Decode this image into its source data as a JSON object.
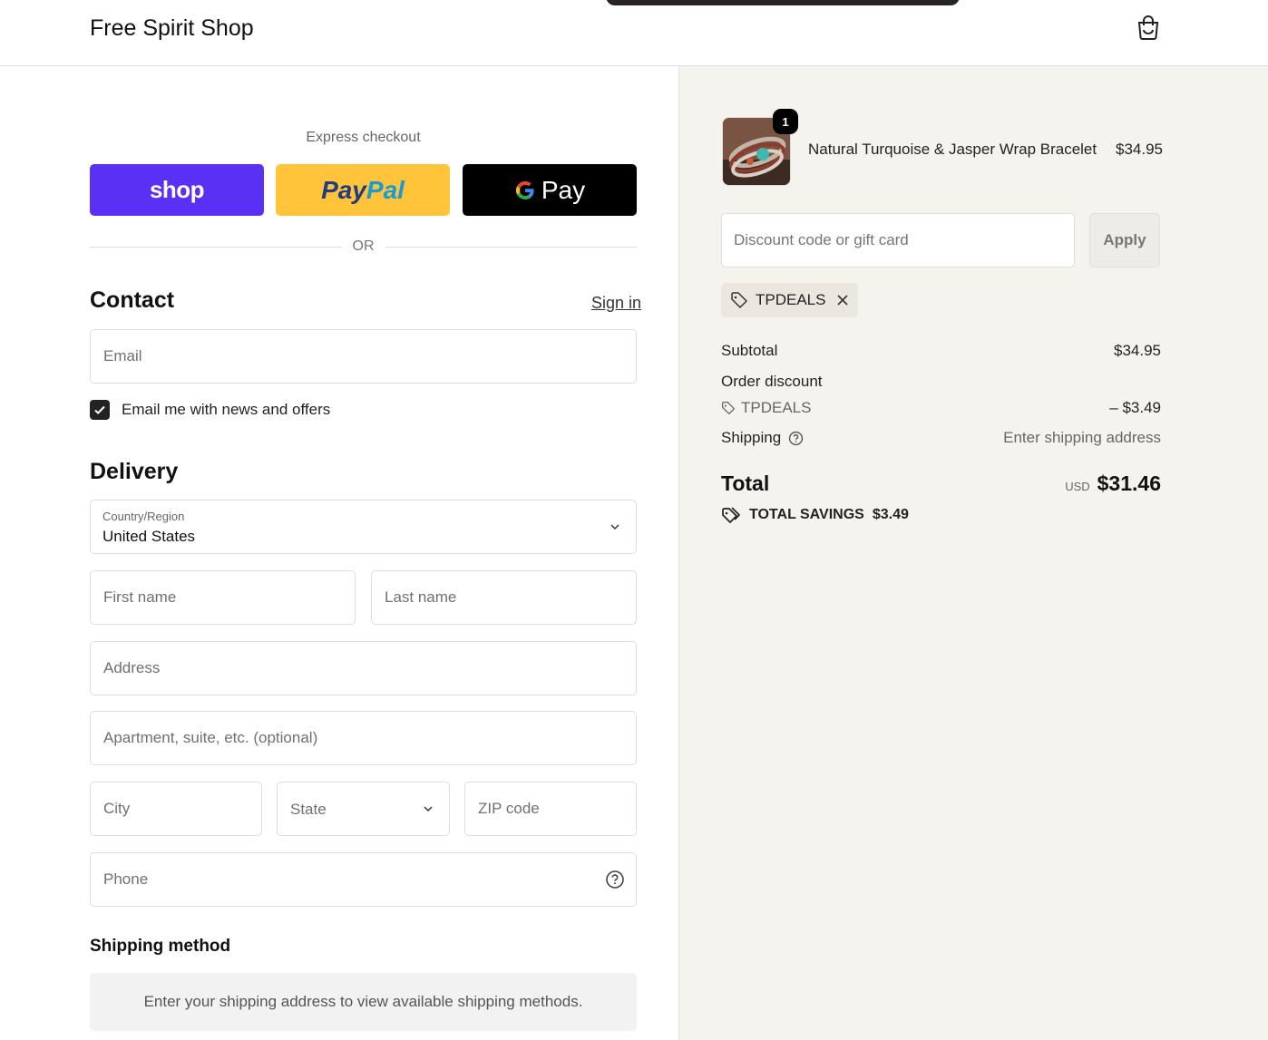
{
  "header": {
    "shop_title": "Free Spirit Shop",
    "cart_icon": "shopping-bag-icon"
  },
  "express": {
    "label": "Express checkout",
    "shop_pay_label": "shop",
    "paypal_part1": "Pay",
    "paypal_part2": "Pal",
    "gpay_label": "Pay",
    "or_label": "OR"
  },
  "contact": {
    "heading": "Contact",
    "sign_in": "Sign in",
    "email_placeholder": "Email",
    "newsletter_label": "Email me with news and offers",
    "newsletter_checked": true
  },
  "delivery": {
    "heading": "Delivery",
    "country_label": "Country/Region",
    "country_value": "United States",
    "first_name_placeholder": "First name",
    "last_name_placeholder": "Last name",
    "address_placeholder": "Address",
    "apartment_placeholder": "Apartment, suite, etc. (optional)",
    "city_placeholder": "City",
    "state_placeholder": "State",
    "zip_placeholder": "ZIP code",
    "phone_placeholder": "Phone"
  },
  "shipping_method": {
    "heading": "Shipping method",
    "info": "Enter your shipping address to view available shipping methods."
  },
  "summary": {
    "product": {
      "quantity": "1",
      "name": "Natural Turquoise & Jasper Wrap Bracelet",
      "price": "$34.95"
    },
    "discount_placeholder": "Discount code or gift card",
    "apply_label": "Apply",
    "applied_code": "TPDEALS",
    "subtotal_label": "Subtotal",
    "subtotal_value": "$34.95",
    "order_discount_label": "Order discount",
    "discount_code": "TPDEALS",
    "discount_value": "– $3.49",
    "shipping_label": "Shipping",
    "shipping_value": "Enter shipping address",
    "total_label": "Total",
    "total_currency": "USD",
    "total_value": "$31.46",
    "savings_label": "TOTAL SAVINGS",
    "savings_value": "$3.49"
  },
  "colors": {
    "shop_pay": "#5a31f4",
    "paypal": "#ffc439",
    "gpay": "#000000",
    "summary_bg": "#f5f3ee"
  }
}
